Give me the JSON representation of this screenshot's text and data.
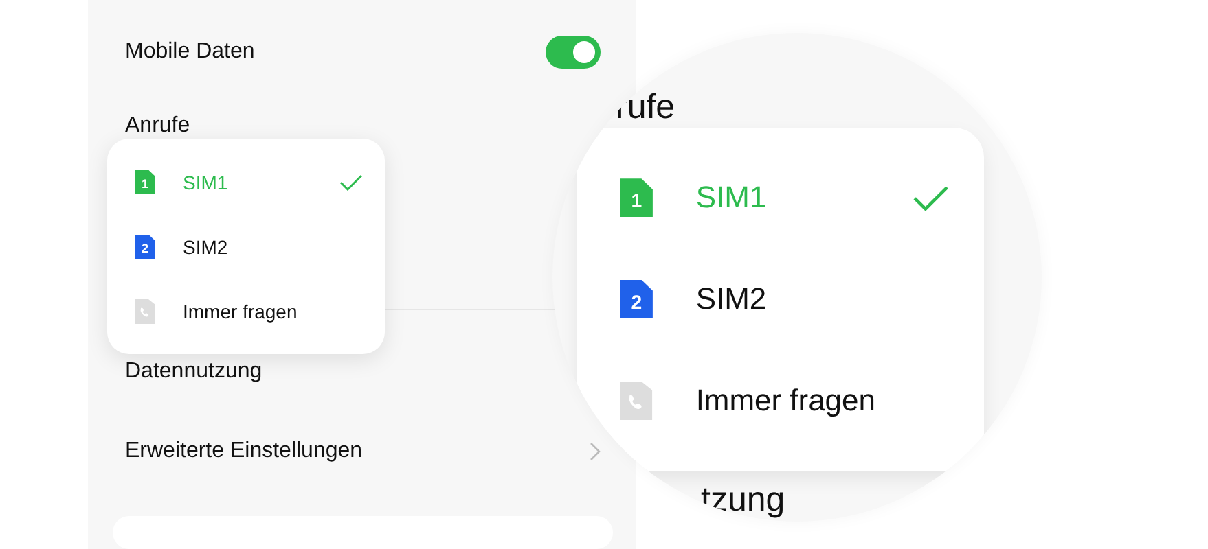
{
  "settings": {
    "rows": [
      {
        "kind": "toggle",
        "label": "Mobile Daten",
        "on": true
      },
      {
        "kind": "heading",
        "label": "Anrufe"
      },
      {
        "kind": "plain",
        "label": "Datennutzung"
      },
      {
        "kind": "link",
        "label": "Erweiterte Einstellungen"
      }
    ]
  },
  "popup": {
    "items": [
      {
        "kind": "sim",
        "badge": "1",
        "color": "#2dbb4e",
        "label": "SIM1",
        "selected": true
      },
      {
        "kind": "sim",
        "badge": "2",
        "color": "#2061ea",
        "label": "SIM2",
        "selected": false
      },
      {
        "kind": "phone",
        "label": "Immer fragen",
        "selected": false
      }
    ]
  },
  "magnifier": {
    "heading": "rufe",
    "items": [
      {
        "kind": "sim",
        "badge": "1",
        "color": "#2dbb4e",
        "label": "SIM1",
        "selected": true
      },
      {
        "kind": "sim",
        "badge": "2",
        "color": "#2061ea",
        "label": "SIM2",
        "selected": false
      },
      {
        "kind": "phone",
        "label": "Immer fragen",
        "selected": false
      }
    ],
    "footer": "tzung"
  }
}
